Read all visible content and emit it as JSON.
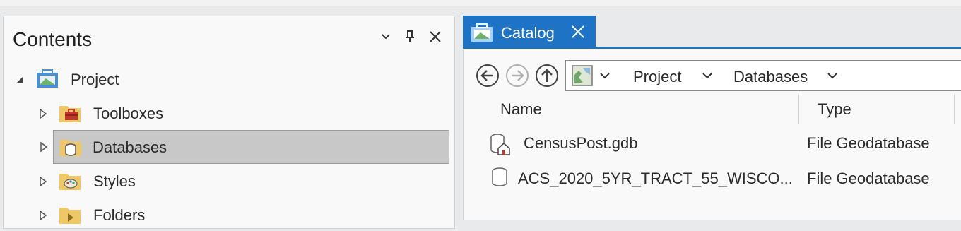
{
  "contents_pane": {
    "title": "Contents",
    "controls": [
      "chevron-down-icon",
      "pin-icon",
      "close-icon"
    ],
    "tree": [
      {
        "label": "Project",
        "icon": "project-icon",
        "expanded": true
      },
      {
        "label": "Toolboxes",
        "icon": "toolbox-folder-icon"
      },
      {
        "label": "Databases",
        "icon": "database-folder-icon",
        "selected": true
      },
      {
        "label": "Styles",
        "icon": "styles-folder-icon"
      },
      {
        "label": "Folders",
        "icon": "folder-icon"
      }
    ]
  },
  "catalog_pane": {
    "tab_label": "Catalog",
    "address": {
      "crumbs": [
        "Project",
        "Databases"
      ]
    },
    "columns": {
      "name": "Name",
      "type": "Type"
    },
    "items": [
      {
        "name": "CensusPost.gdb",
        "type": "File Geodatabase",
        "icon": "home-database-icon"
      },
      {
        "name": "ACS_2020_5YR_TRACT_55_WISCO...",
        "type": "File Geodatabase",
        "icon": "database-icon"
      }
    ]
  },
  "colors": {
    "accent": "#1e73c4",
    "selection": "#c8c8c8",
    "folder": "#f0c766",
    "pane_bg": "#f9f9f9"
  }
}
